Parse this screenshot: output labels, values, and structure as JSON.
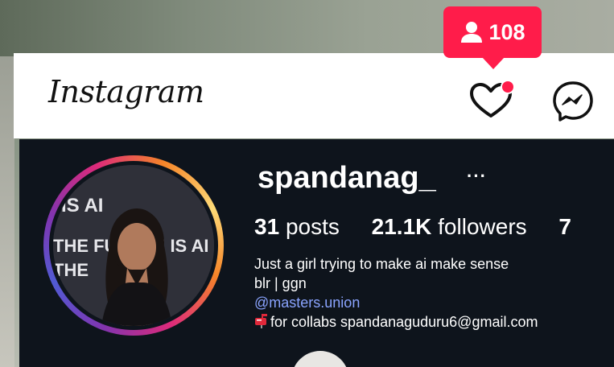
{
  "app": {
    "logo_text": "Instagram"
  },
  "notifications": {
    "count": "108",
    "icon": "person-icon",
    "color": "#ff1c4a"
  },
  "header_icons": {
    "activity": "heart-icon",
    "messages": "messenger-icon"
  },
  "profile": {
    "username": "spandanag_",
    "more_label": "···",
    "stats": [
      {
        "value": "31",
        "label": "posts"
      },
      {
        "value": "21.1K",
        "label": "followers"
      },
      {
        "value": "7",
        "label": ""
      }
    ],
    "bio": {
      "line1": "Just a girl trying to make ai make sense",
      "line2": "blr | ggn",
      "mention": "@masters.union",
      "contact": "for collabs spandanaguduru6@gmail.com",
      "contact_icon": "mailbox-icon"
    },
    "avatar_text": {
      "line_is_ai": "IS AI",
      "line_the_future": "THE FUTURE IS AI",
      "line_the": "THE"
    }
  },
  "colors": {
    "panel_bg": "#0e141c",
    "link": "#8aa4ff",
    "badge": "#ff1c4a"
  }
}
